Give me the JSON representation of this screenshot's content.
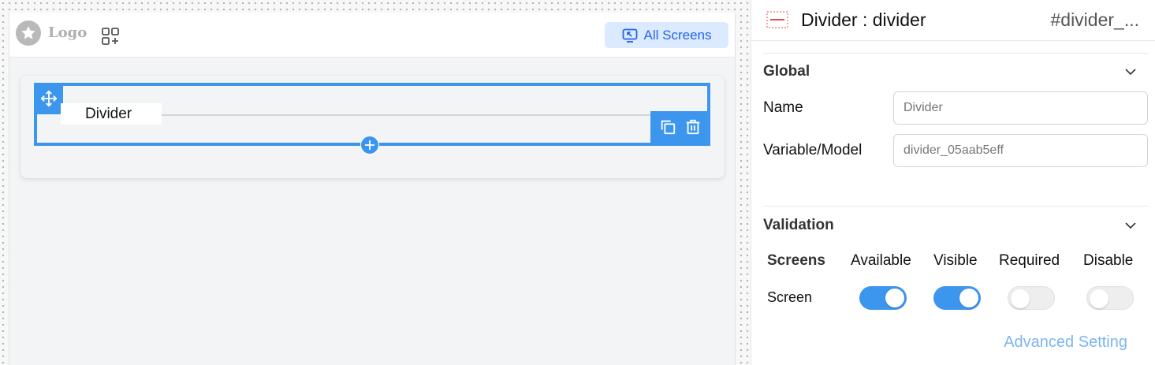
{
  "canvas": {
    "logo_text": "Logo",
    "all_screens_label": "All Screens",
    "divider_label": "Divider"
  },
  "panel": {
    "title": "Divider : divider",
    "component_id": "#divider_...",
    "global": {
      "title": "Global",
      "name_label": "Name",
      "name_value": "Divider",
      "variable_label": "Variable/Model",
      "variable_value": "divider_05aab5eff"
    },
    "validation": {
      "title": "Validation",
      "headers": {
        "screens": "Screens",
        "available": "Available",
        "visible": "Visible",
        "required": "Required",
        "disable": "Disable"
      },
      "rows": [
        {
          "label": "Screen",
          "available": true,
          "visible": true,
          "required": false,
          "disable": false
        }
      ]
    },
    "advanced_setting": "Advanced Setting"
  },
  "colors": {
    "accent": "#3d96ee",
    "accent_light": "#dbeafe",
    "link": "#7cb6f2",
    "logo_gray": "#b9b9b9"
  },
  "icons": {
    "logo": "star-icon",
    "apps": "apps-add-icon",
    "all_screens": "screen-icon",
    "move": "move-icon",
    "copy": "copy-icon",
    "delete": "trash-icon",
    "add": "plus-icon",
    "collapse": "chevron-down-icon"
  }
}
